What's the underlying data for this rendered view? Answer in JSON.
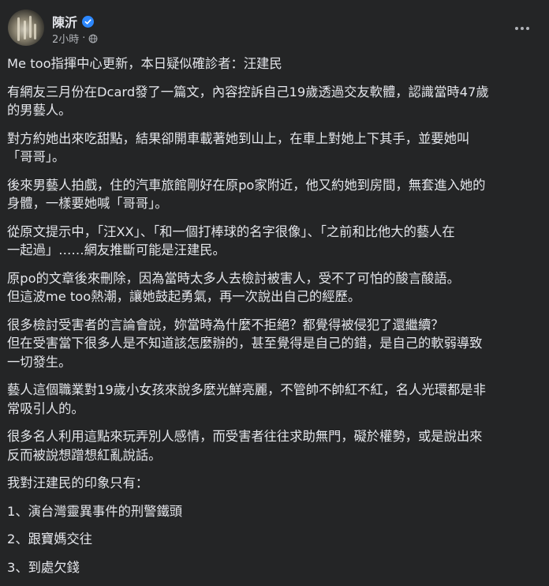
{
  "author": {
    "name": "陳沂",
    "time": "2小時"
  },
  "icons": {
    "verified": "verified-badge-icon",
    "privacy": "globe-icon",
    "more": "more-options-icon"
  },
  "colors": {
    "background": "#242526",
    "text": "#e4e6eb",
    "secondary_text": "#b0b3b8",
    "verified_blue": "#2d88ff"
  },
  "post": {
    "paragraphs": [
      "Me too指揮中心更新，本日疑似確診者：汪建民",
      "有網友三月份在Dcard發了一篇文，內容控訴自己19歲透過交友軟體，認識當時47歲\n的男藝人。",
      "對方約她出來吃甜點，結果卻開車載著她到山上，在車上對她上下其手，並要她叫\n「哥哥」。",
      "後來男藝人拍戲，住的汽車旅館剛好在原po家附近，他又約她到房間，無套進入她的\n身體，一樣要她喊「哥哥」。",
      "從原文提示中，「汪XX」、「和一個打棒球的名字很像」、「之前和比他大的藝人在\n一起過」……網友推斷可能是汪建民。",
      "原po的文章後來刪除，因為當時太多人去檢討被害人，受不了可怕的酸言酸語。\n但這波me too熱潮，讓她鼓起勇氣，再一次說出自己的經歷。",
      "很多檢討受害者的言論會說，妳當時為什麼不拒絕？都覺得被侵犯了還繼續？\n但在受害當下很多人是不知道該怎麼辦的，甚至覺得是自己的錯，是自己的軟弱導致\n一切發生。",
      "藝人這個職業對19歲小女孩來說多麼光鮮亮麗，不管帥不帥紅不紅，名人光環都是非\n常吸引人的。",
      "很多名人利用這點來玩弄別人感情，而受害者往往求助無門，礙於權勢，或是說出來\n反而被說想蹭想紅亂說話。",
      "我對汪建民的印象只有：",
      "1、演台灣靈異事件的刑警鐵頭",
      "2、跟寶媽交往",
      "3、到處欠錢"
    ]
  }
}
